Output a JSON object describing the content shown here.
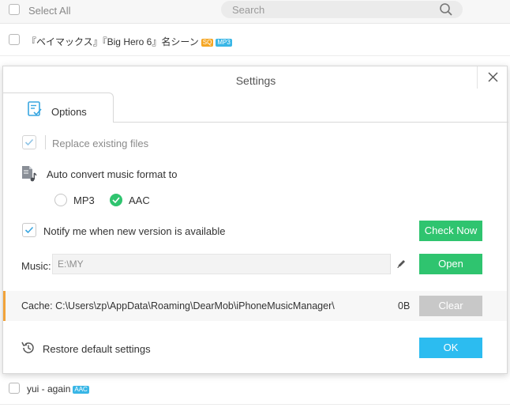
{
  "background": {
    "select_all": "Select All",
    "search_placeholder": "Search",
    "rows": [
      {
        "title": "『ベイマックス』『Big Hero 6』名シーン",
        "tags": [
          "SQ",
          "MP3"
        ]
      },
      {
        "title": "yui - again",
        "tags": [
          "AAC"
        ]
      }
    ]
  },
  "dialog": {
    "title": "Settings",
    "tab_options": "Options",
    "replace_existing": "Replace existing files",
    "auto_convert": "Auto convert music format to",
    "format_mp3": "MP3",
    "format_aac": "AAC",
    "selected_format": "AAC",
    "notify": "Notify me when new version is available",
    "check_now": "Check Now",
    "music_label": "Music:",
    "music_path": "E:\\MY",
    "open": "Open",
    "cache_label": "Cache: C:\\Users\\zp\\AppData\\Roaming\\DearMob\\iPhoneMusicManager\\",
    "cache_size": "0B",
    "clear": "Clear",
    "restore": "Restore default settings",
    "ok": "OK"
  },
  "colors": {
    "green": "#2fc46f",
    "blue": "#2cbcf0",
    "accent_orange": "#f2a33a"
  }
}
